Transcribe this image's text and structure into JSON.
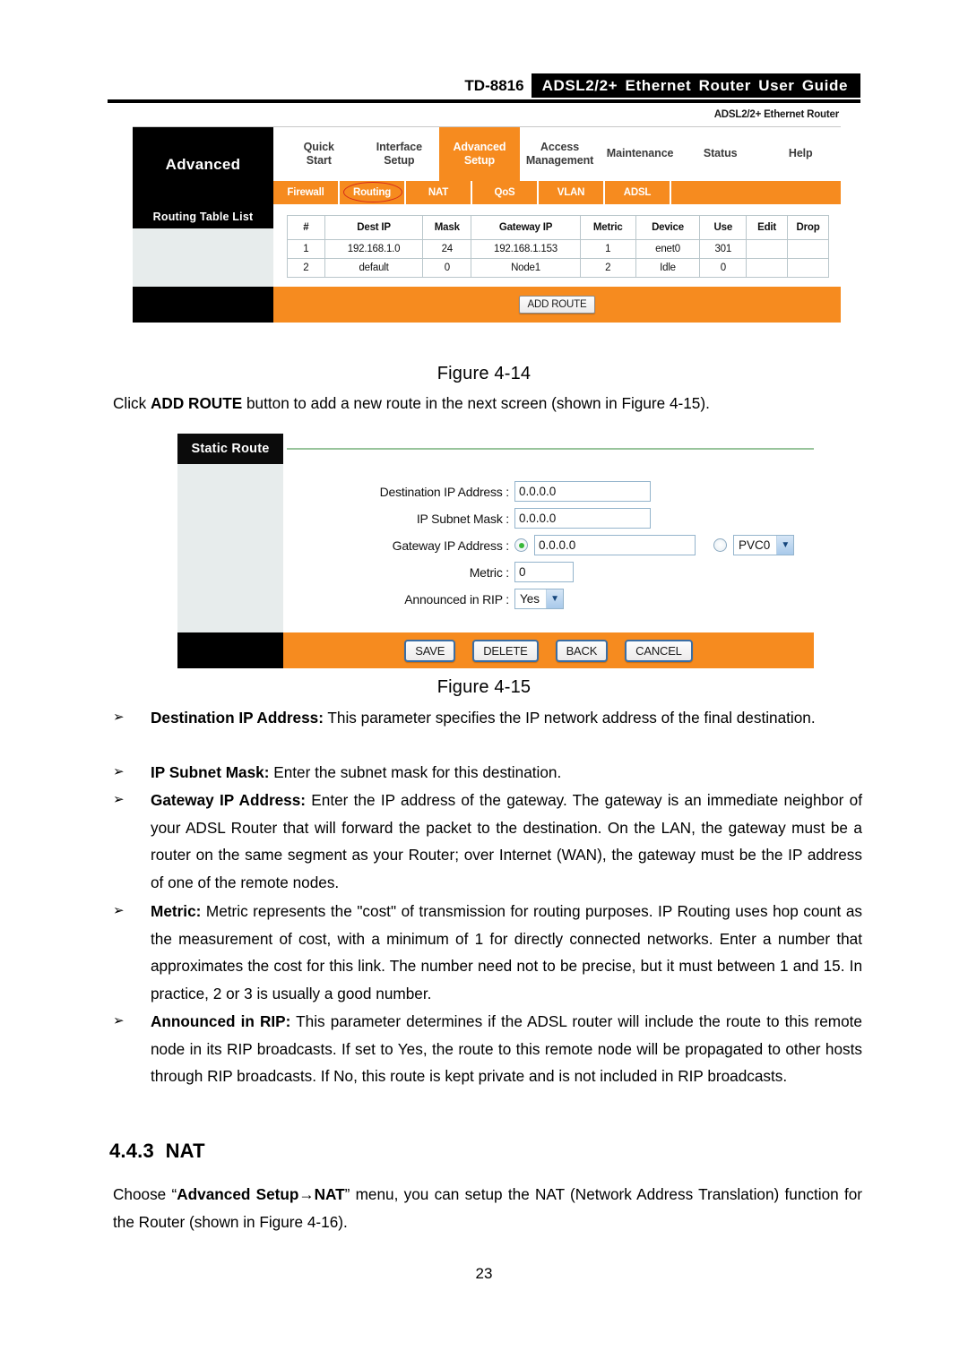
{
  "header": {
    "model": "TD-8816",
    "title": "ADSL2/2+ Ethernet Router User Guide"
  },
  "figure_14": {
    "brand_label": "ADSL2/2+ Ethernet Router",
    "logo_label": "Advanced",
    "main_tabs": [
      {
        "line1": "Quick",
        "line2": "Start",
        "active": false
      },
      {
        "line1": "Interface",
        "line2": "Setup",
        "active": false
      },
      {
        "line1": "Advanced",
        "line2": "Setup",
        "active": true
      },
      {
        "line1": "Access",
        "line2": "Management",
        "active": false
      },
      {
        "line1": "Maintenance",
        "line2": "",
        "active": false
      },
      {
        "line1": "Status",
        "line2": "",
        "active": false
      },
      {
        "line1": "Help",
        "line2": "",
        "active": false
      }
    ],
    "sub_tabs": [
      {
        "label": "Firewall",
        "marked": false
      },
      {
        "label": "Routing",
        "marked": true
      },
      {
        "label": "NAT",
        "marked": false
      },
      {
        "label": "QoS",
        "marked": false
      },
      {
        "label": "VLAN",
        "marked": false
      },
      {
        "label": "ADSL",
        "marked": false
      }
    ],
    "side_title": "Routing Table List",
    "table": {
      "columns": [
        "#",
        "Dest IP",
        "Mask",
        "Gateway IP",
        "Metric",
        "Device",
        "Use",
        "Edit",
        "Drop"
      ],
      "rows": [
        [
          "1",
          "192.168.1.0",
          "24",
          "192.168.1.153",
          "1",
          "enet0",
          "301",
          "",
          ""
        ],
        [
          "2",
          "default",
          "0",
          "Node1",
          "2",
          "Idle",
          "0",
          "",
          ""
        ]
      ]
    },
    "add_route_label": "ADD ROUTE",
    "caption": "Figure  4-14"
  },
  "intro_paragraph": {
    "before": "Click ",
    "bold": "ADD ROUTE",
    "after": " button to add a new route in the next screen (shown in Figure  4-15)."
  },
  "figure_15": {
    "panel_title": "Static Route",
    "fields": [
      {
        "label": "Destination IP Address :",
        "value": "0.0.0.0"
      },
      {
        "label": "IP Subnet Mask :",
        "value": "0.0.0.0"
      },
      {
        "label": "Gateway IP Address :",
        "value": "0.0.0.0"
      },
      {
        "label": "Metric :",
        "value": "0"
      },
      {
        "label": "Announced in RIP :",
        "value": "Yes"
      }
    ],
    "gateway_radio_ip_selected": true,
    "gateway_pvc_value": "PVC0",
    "rip_value": "Yes",
    "buttons": [
      "SAVE",
      "DELETE",
      "BACK",
      "CANCEL"
    ],
    "caption": "Figure  4-15"
  },
  "bullets": [
    {
      "term": "Destination  IP  Address:",
      "text": " This  parameter  specifies  the  IP  network  address  of  the  final destination."
    },
    {
      "term": "IP Subnet Mask:",
      "text": " Enter the subnet mask for this destination."
    },
    {
      "term": "Gateway IP Address:",
      "text": " Enter the IP address of the gateway. The gateway is an immediate neighbor of your ADSL Router that will forward the packet to the destination. On the LAN, the gateway must be a router on the same segment as your Router; over Internet (WAN), the gateway must be the IP address of one of the remote nodes."
    },
    {
      "term": "Metric:",
      "text": " Metric represents the \"cost\" of transmission for routing purposes. IP Routing uses hop count as the measurement of cost, with a minimum of 1 for directly connected networks. Enter a number that approximates the cost for this link. The number need not to be precise, but it must between 1 and 15. In practice, 2 or 3 is usually a good number."
    },
    {
      "term": "Announced in RIP:",
      "text": " This parameter determines if the ADSL router will include the route to this remote node in its RIP broadcasts. If set to Yes, the route to this remote node will be propagated to other hosts through RIP broadcasts. If No, this route is kept private and is not included in RIP broadcasts."
    }
  ],
  "section": {
    "number": "4.4.3",
    "title": "NAT",
    "paragraph_before": "Choose “",
    "paragraph_bold": "Advanced Setup→NAT",
    "paragraph_after": "” menu, you can setup the NAT (Network Address Translation) function for the Router (shown in Figure 4-16)."
  },
  "page_number": "23",
  "icons": {
    "bullet_arrow": "➢",
    "chevron_down": "▼"
  },
  "colors": {
    "orange": "#f68b1f",
    "black": "#000000",
    "panel_gray": "#e7ecec",
    "annotation_red": "#d42a1a",
    "radio_green": "#37b83a",
    "rule_green": "#98c49b"
  }
}
